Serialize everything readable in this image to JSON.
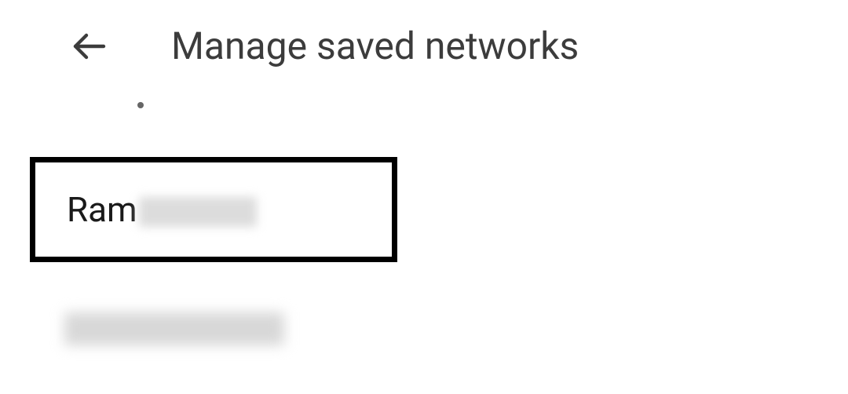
{
  "header": {
    "title": "Manage saved networks"
  },
  "networks": [
    {
      "name_visible": "Ram",
      "name_redacted": true,
      "selected": true
    },
    {
      "name_visible": "",
      "name_redacted": true,
      "selected": false
    }
  ]
}
